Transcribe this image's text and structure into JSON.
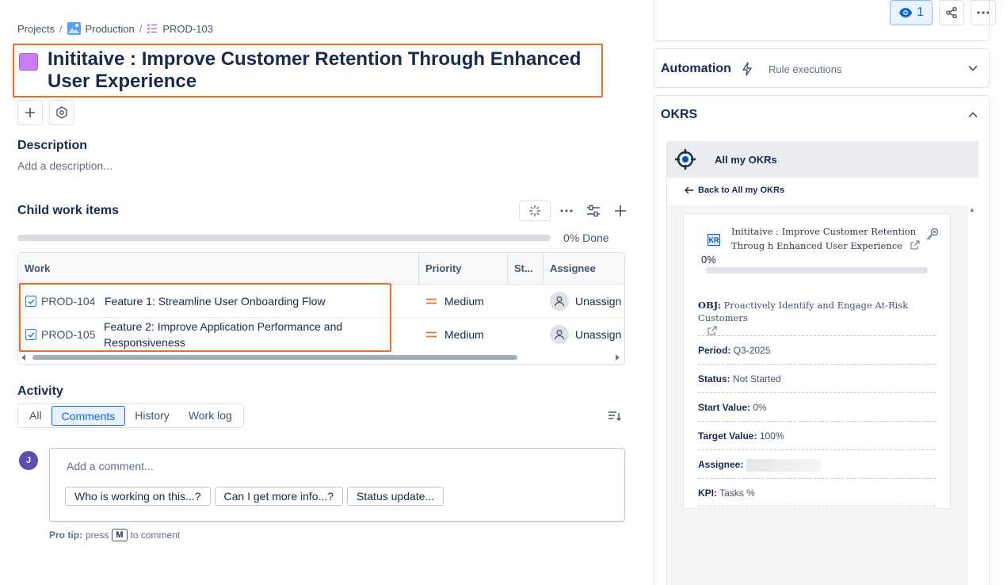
{
  "toolbar": {
    "watch_count": "1"
  },
  "breadcrumb": {
    "projects": "Projects",
    "project": "Production",
    "issue": "PROD-103"
  },
  "issue": {
    "title": "Inititaive : Improve Customer Retention Through Enhanced User Experience",
    "color": "#c97cf4"
  },
  "description": {
    "heading": "Description",
    "placeholder": "Add a description..."
  },
  "child_items": {
    "heading": "Child work items",
    "progress_label": "0% Done",
    "progress": 0,
    "columns": [
      "Work",
      "Priority",
      "St...",
      "Assignee"
    ],
    "rows": [
      {
        "key": "PROD-104",
        "summary": "Feature 1: Streamline User Onboarding Flow",
        "priority": "Medium",
        "assignee": "Unassign"
      },
      {
        "key": "PROD-105",
        "summary": "Feature 2: Improve Application Performance and Responsiveness",
        "priority": "Medium",
        "assignee": "Unassign"
      }
    ]
  },
  "activity": {
    "heading": "Activity",
    "tabs": [
      "All",
      "Comments",
      "History",
      "Work log"
    ],
    "active_tab": "Comments",
    "avatar_initial": "J",
    "comment_placeholder": "Add a comment...",
    "quick_replies": [
      "Who is working on this...?",
      "Can I get more info...?",
      "Status update..."
    ],
    "protip_prefix": "Pro tip:",
    "protip_press": "press",
    "protip_key": "M",
    "protip_suffix": "to comment"
  },
  "automation": {
    "title": "Automation",
    "subtitle": "Rule executions"
  },
  "okrs": {
    "title": "OKRS",
    "app_title": "All my OKRs",
    "back_label": "Back to All my OKRs",
    "kr_badge": "KR",
    "kr_title": "Inititaive : Improve Customer Retention Throug h Enhanced User Experience",
    "kr_percent": "0%",
    "kr_progress": 0,
    "obj_label": "OBJ:",
    "obj_value": "Proactively Identify and Engage At-Risk Customers",
    "fields": [
      {
        "label": "Period:",
        "value": "Q3-2025"
      },
      {
        "label": "Status:",
        "value": "Not Started"
      },
      {
        "label": "Start Value:",
        "value": "0%"
      },
      {
        "label": "Target Value:",
        "value": "100%"
      },
      {
        "label": "Assignee:",
        "value": ""
      },
      {
        "label": "KPI:",
        "value": "Tasks %"
      }
    ]
  },
  "colors": {
    "accent": "#0c66e4",
    "highlight": "#f06a1f"
  }
}
